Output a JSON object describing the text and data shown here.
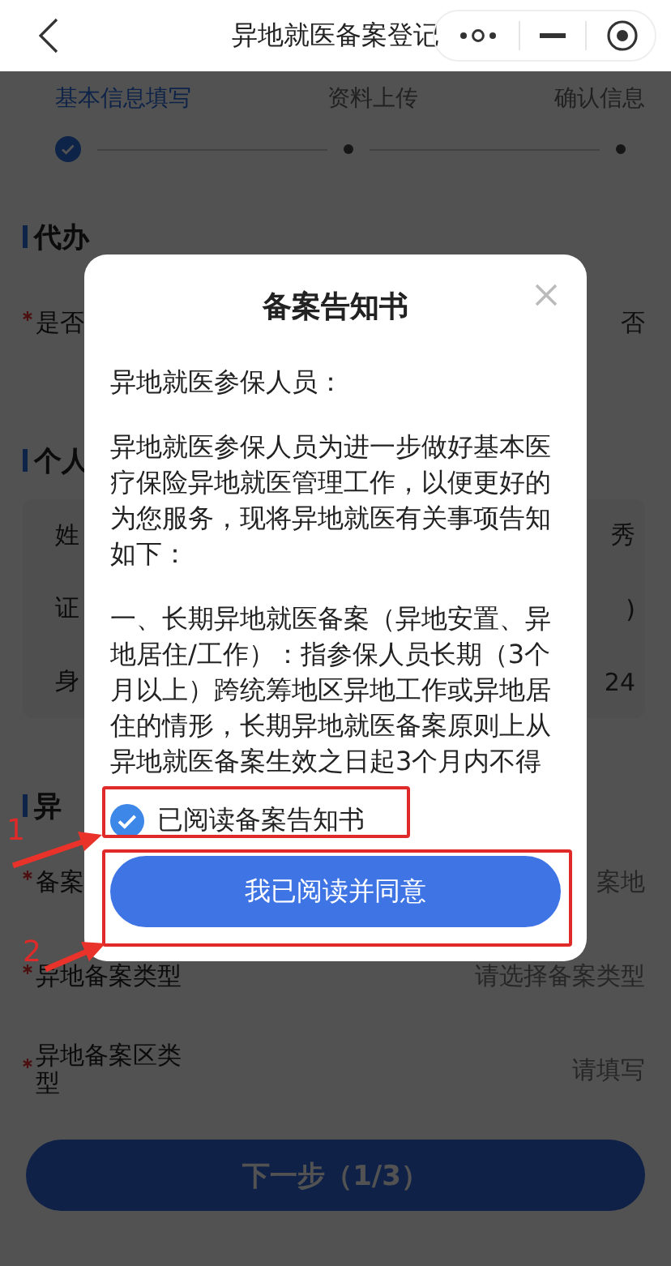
{
  "nav": {
    "title": "异地就医备案登记"
  },
  "steps": [
    {
      "label": "基本信息填写",
      "selected": true
    },
    {
      "label": "资料上传",
      "selected": false
    },
    {
      "label": "确认信息",
      "selected": false
    }
  ],
  "sections": [
    {
      "title": "代办",
      "kind": "plain",
      "rows": [
        {
          "required": true,
          "label": "是否",
          "value": "否"
        }
      ]
    },
    {
      "title": "个人",
      "kind": "card",
      "rows": [
        {
          "required": false,
          "label": "姓",
          "value": "秀"
        },
        {
          "required": false,
          "label": "证",
          "value": ")"
        },
        {
          "required": false,
          "label": "身",
          "value": "24"
        }
      ]
    },
    {
      "title": "异",
      "kind": "plain",
      "rows": [
        {
          "required": true,
          "label": "备案",
          "placeholder": "案地"
        },
        {
          "required": true,
          "label": "异地备案类型",
          "placeholder": "请选择备案类型"
        },
        {
          "required": true,
          "label": "异地备案区类型",
          "placeholder": "请填写"
        }
      ]
    }
  ],
  "next_button": "下一步（1/3）",
  "dialog": {
    "title": "备案告知书",
    "paragraphs": [
      "异地就医参保人员：",
      "异地就医参保人员为进一步做好基本医疗保险异地就医管理工作，以便更好的为您服务，现将异地就医有关事项告知如下：",
      "一、长期异地就医备案（异地安置、异地居住/工作）：指参保人员长期（3个月以上）跨统筹地区异地工作或异地居住的情形，长期异地就医备案原则上从异地就医备案生效之日起3个月内不得"
    ],
    "checkbox": {
      "label": "已阅读备案告知书",
      "checked": true
    },
    "agree_button": "我已阅读并同意"
  },
  "annotations": [
    {
      "label": "1"
    },
    {
      "label": "2"
    }
  ]
}
